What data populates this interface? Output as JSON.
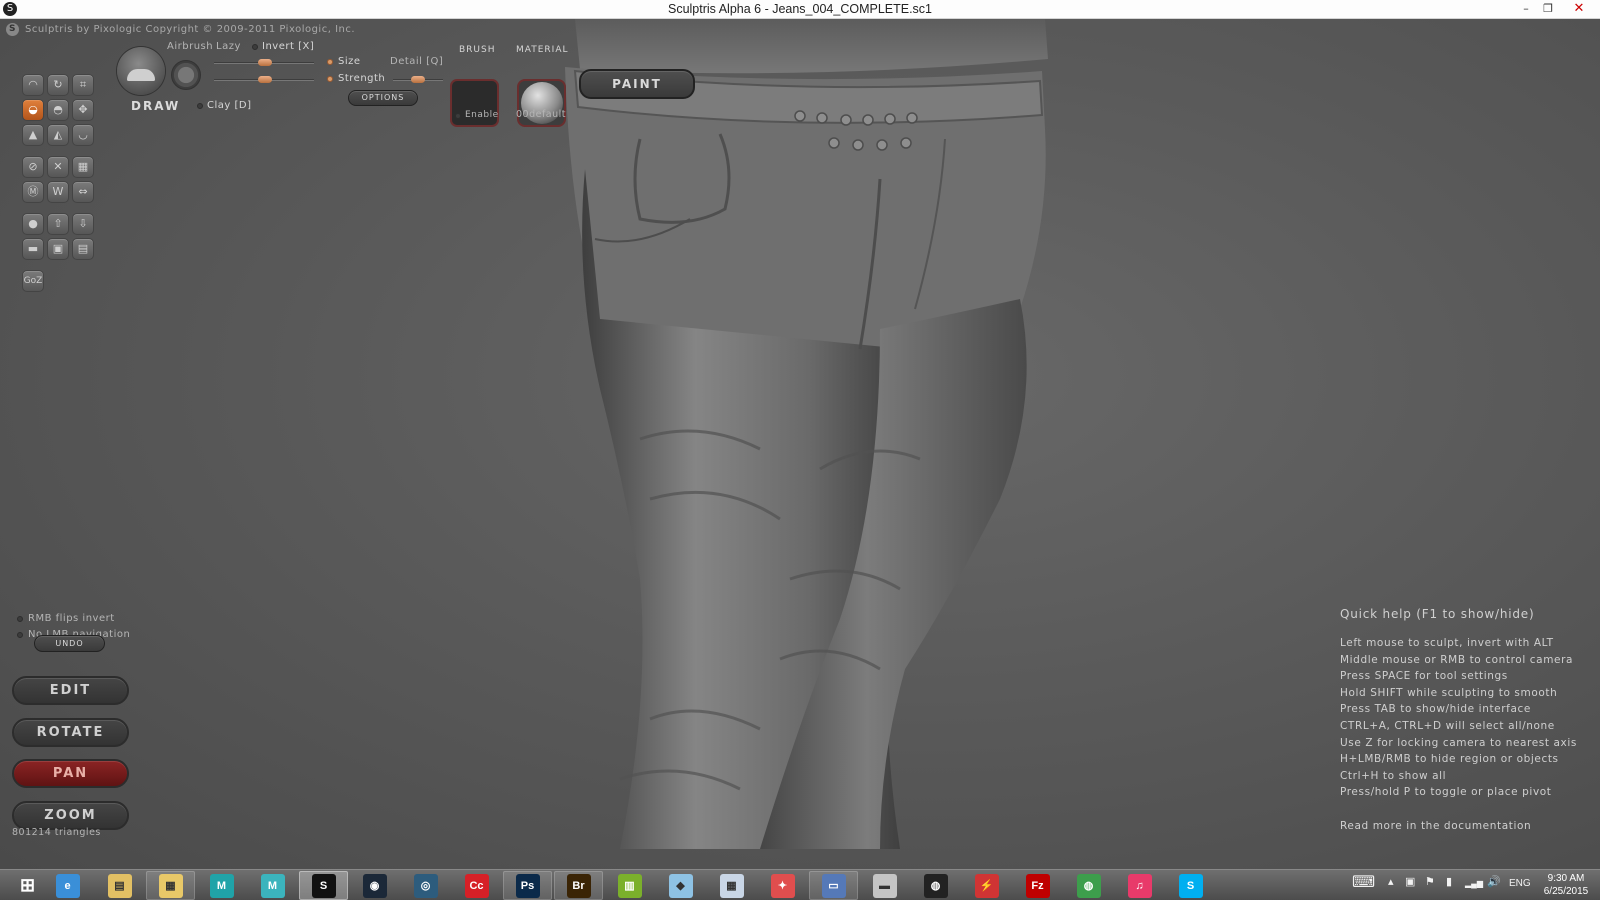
{
  "window": {
    "title": "Sculptris Alpha 6 - Jeans_004_COMPLETE.sc1",
    "minimize": "–",
    "maximize": "❐",
    "close": "✕"
  },
  "viewport": {
    "copyright": "Sculptris by Pixologic   Copyright © 2009-2011 Pixologic, Inc."
  },
  "toolbar": {
    "tool_icons": [
      "draw-icon",
      "rotate-icon",
      "crop-icon",
      "clay-icon",
      "flatten-icon",
      "grab-icon",
      "inflate-icon",
      "pinch-icon",
      "smooth-icon",
      "symmetry-icon",
      "wireframe-icon",
      "grid-icon",
      "reduce-icon",
      "subdivide-icon",
      "mirror-icon",
      "sphere-icon",
      "import-icon",
      "export-icon",
      "plane-icon",
      "save-icon",
      "open-icon",
      "goz-icon"
    ],
    "goz_label": "GoZ",
    "brush_name": "DRAW",
    "airbrush": "Airbrush",
    "lazy": "Lazy",
    "invert": "Invert [X]",
    "size": "Size",
    "detail": "Detail [Q]",
    "strength": "Strength",
    "options": "OPTIONS",
    "clay": "Clay [D]",
    "brush_header": "BRUSH",
    "enable": "Enable",
    "material_header": "MATERIAL",
    "material_name": "00default",
    "paint": "PAINT",
    "size_value": 0.47,
    "strength_value": 0.47,
    "detail_value": 0.5
  },
  "left_panel": {
    "rmb_flips_invert": "RMB flips invert",
    "no_lmb_navigation": "No LMB navigation",
    "undo": "UNDO",
    "edit": "EDIT",
    "rotate": "ROTATE",
    "pan": "PAN",
    "zoom": "ZOOM",
    "triangles": "801214 triangles"
  },
  "quick_help": {
    "title": "Quick help (F1 to show/hide)",
    "lines": [
      "Left mouse to sculpt, invert with ALT",
      "Middle mouse or RMB to control camera",
      "Press SPACE for tool settings",
      "Hold SHIFT while sculpting to smooth",
      "Press TAB to show/hide interface",
      "CTRL+A, CTRL+D will select all/none",
      "Use Z for locking camera to nearest axis",
      "H+LMB/RMB to hide region or objects",
      "Ctrl+H to show all",
      "Press/hold P to toggle or place pivot"
    ],
    "documentation": "Read more in the documentation"
  },
  "taskbar": {
    "apps": [
      {
        "name": "start-button",
        "label": "⊞",
        "color": "#ffffff",
        "state": "none"
      },
      {
        "name": "internet-explorer-icon",
        "label": "e",
        "color": "#3a8fd8",
        "state": "none"
      },
      {
        "name": "file-explorer-icon",
        "label": "▤",
        "color": "#e2c064",
        "state": "none"
      },
      {
        "name": "folder-icon",
        "label": "▦",
        "color": "#e8c868",
        "state": "open"
      },
      {
        "name": "maya-lt-icon",
        "label": "M",
        "color": "#20a3a8",
        "state": "none"
      },
      {
        "name": "mudbox-icon",
        "label": "M",
        "color": "#3bb4bd",
        "state": "none"
      },
      {
        "name": "sculptris-icon",
        "label": "S",
        "color": "#111111",
        "state": "current"
      },
      {
        "name": "steam-icon",
        "label": "◉",
        "color": "#1b2838",
        "state": "none"
      },
      {
        "name": "unity-icon",
        "label": "◎",
        "color": "#2d5c7d",
        "state": "none"
      },
      {
        "name": "creative-cloud-icon",
        "label": "Cc",
        "color": "#d62027",
        "state": "none"
      },
      {
        "name": "photoshop-icon",
        "label": "Ps",
        "color": "#0b2a4a",
        "state": "open"
      },
      {
        "name": "bridge-icon",
        "label": "Br",
        "color": "#3a2405",
        "state": "open"
      },
      {
        "name": "spreadsheet-icon",
        "label": "▥",
        "color": "#7bb02b",
        "state": "none"
      },
      {
        "name": "notes-icon",
        "label": "◆",
        "color": "#8ec2e4",
        "state": "none"
      },
      {
        "name": "calculator-icon",
        "label": "▦",
        "color": "#c9d6e6",
        "state": "none"
      },
      {
        "name": "ubisoft-icon",
        "label": "✦",
        "color": "#e04e4e",
        "state": "none"
      },
      {
        "name": "remote-desktop-icon",
        "label": "▭",
        "color": "#5579b8",
        "state": "open"
      },
      {
        "name": "scanner-icon",
        "label": "▬",
        "color": "#c5c5c5",
        "state": "none"
      },
      {
        "name": "nvidia-icon",
        "label": "◍",
        "color": "#222222",
        "state": "none"
      },
      {
        "name": "lightning-icon",
        "label": "⚡",
        "color": "#d03434",
        "state": "none"
      },
      {
        "name": "filezilla-icon",
        "label": "Fz",
        "color": "#bf0000",
        "state": "none"
      },
      {
        "name": "network-icon",
        "label": "◍",
        "color": "#3d9e4c",
        "state": "none"
      },
      {
        "name": "itunes-icon",
        "label": "♫",
        "color": "#e83a6a",
        "state": "none"
      },
      {
        "name": "skype-icon",
        "label": "S",
        "color": "#00aff0",
        "state": "none"
      }
    ],
    "keyboard_icon": "⌨",
    "tray_arrow": "▴",
    "tray_icons": [
      "▣",
      "⚑",
      "▮",
      "▂▄▆",
      "🔊"
    ],
    "language": "ENG",
    "time": "9:30 AM",
    "date": "6/25/2015"
  }
}
